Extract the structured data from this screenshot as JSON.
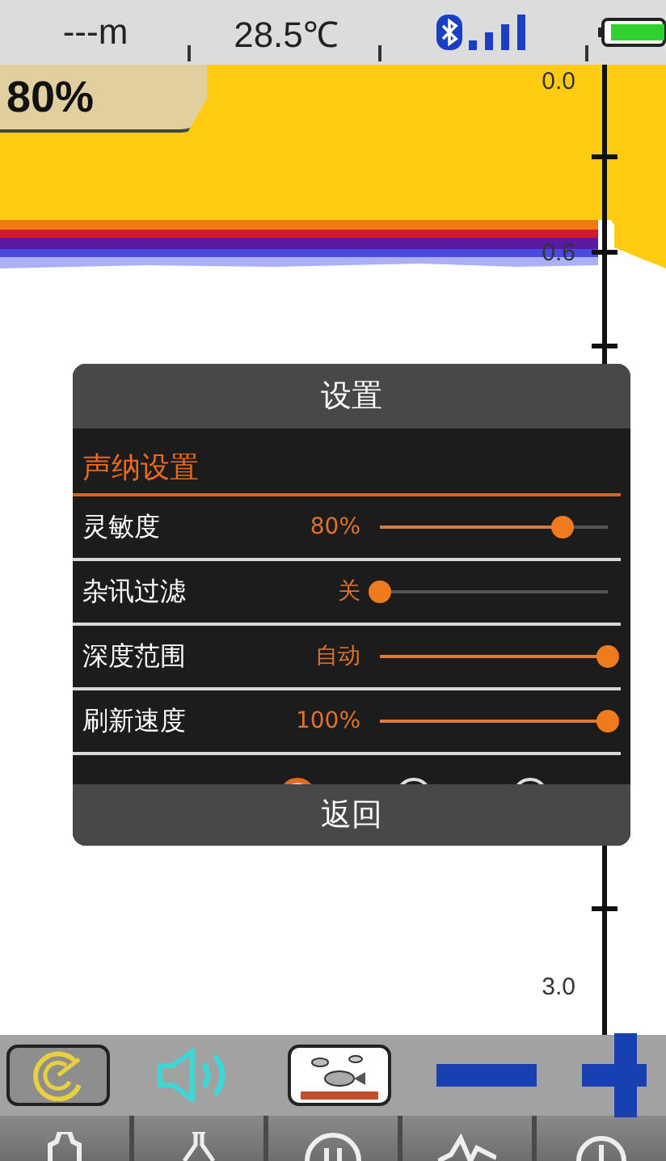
{
  "status_bar": {
    "depth": "---m",
    "temperature": "28.5℃"
  },
  "sonar": {
    "sensitivity_badge": "80%",
    "depth_scale": [
      "0.0",
      "0.6",
      "3.0"
    ]
  },
  "dialog": {
    "title": "设置",
    "section": "声纳设置",
    "rows": [
      {
        "kind": "slider",
        "label": "灵敏度",
        "reading": "80%",
        "level": 0.8
      },
      {
        "kind": "slider",
        "label": "杂讯过滤",
        "reading": "关",
        "level": 0
      },
      {
        "kind": "slider",
        "label": "深度范围",
        "reading": "自动",
        "level": 1
      },
      {
        "kind": "slider",
        "label": "刷新速度",
        "reading": "100%",
        "level": 1
      },
      {
        "kind": "radio",
        "options": [
          {
            "selected": true
          },
          {
            "selected": false
          },
          {
            "selected": false
          }
        ]
      }
    ],
    "back_button": "返回"
  }
}
